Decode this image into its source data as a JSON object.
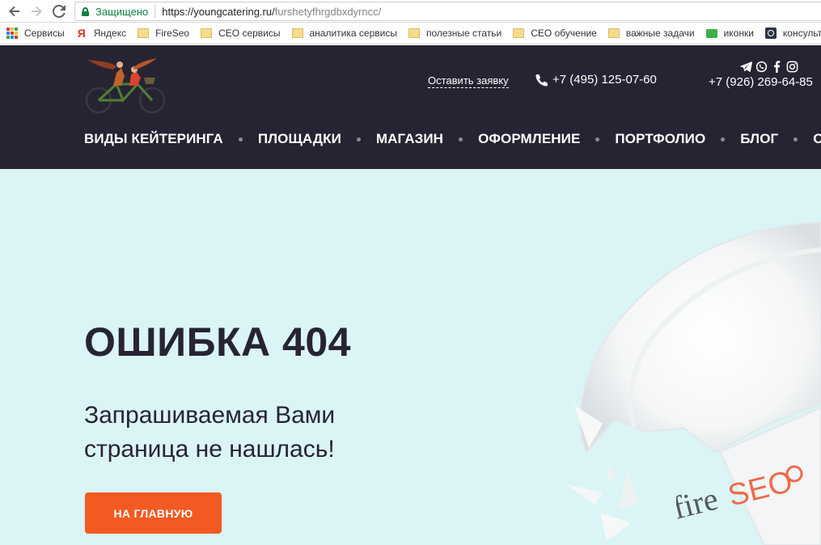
{
  "browser": {
    "secure_label": "Защищено",
    "url_host": "https://youngcatering.ru/",
    "url_path": "furshetyfhrgdbxdyrncc/"
  },
  "bookmarks": [
    {
      "label": "Сервисы",
      "icon": "apps-grid-icon"
    },
    {
      "label": "Яндекс",
      "icon": "yandex-icon"
    },
    {
      "label": "FireSeo",
      "icon": "folder-icon"
    },
    {
      "label": "СЕО сервисы",
      "icon": "folder-icon"
    },
    {
      "label": "аналитика сервисы",
      "icon": "folder-icon"
    },
    {
      "label": "полезные статьи",
      "icon": "folder-icon"
    },
    {
      "label": "СЕО обучение",
      "icon": "folder-icon"
    },
    {
      "label": "важные задачи",
      "icon": "folder-icon"
    },
    {
      "label": "иконки",
      "icon": "green-app-icon"
    },
    {
      "label": "консульта",
      "icon": "dark-app-icon"
    }
  ],
  "header": {
    "request_label": "Оставить заявку",
    "phone1": "+7 (495) 125-07-60",
    "phone2": "+7 (926) 269-64-85"
  },
  "nav": {
    "items": [
      "ВИДЫ КЕЙТЕРИНГА",
      "ПЛОЩАДКИ",
      "МАГАЗИН",
      "ОФОРМЛЕНИЕ",
      "ПОРТФОЛИО",
      "БЛОГ",
      "ОТЗ"
    ]
  },
  "hero": {
    "title": "ОШИБКА 404",
    "text_line1": "Запрашиваемая Вами",
    "text_line2": "страница не нашлась!",
    "button_label": "НА ГЛАВНУЮ",
    "watermark_text_fire": "fire",
    "watermark_text_seo": "SEO"
  },
  "colors": {
    "header_bg": "#262433",
    "hero_bg": "#dbf4f6",
    "accent": "#f35a22"
  }
}
